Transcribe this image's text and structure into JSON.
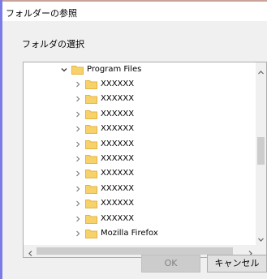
{
  "window": {
    "title": "フォルダーの参照"
  },
  "dialog": {
    "prompt": "フォルダの選択",
    "tree": {
      "root_label": "Program Files",
      "children": [
        "XXXXXX",
        "XXXXXX",
        "XXXXXX",
        "XXXXXX",
        "XXXXXX",
        "XXXXXX",
        "XXXXXX",
        "XXXXXX",
        "XXXXXX",
        "XXXXXX"
      ],
      "partial_child": "Mozilla Firefox"
    },
    "buttons": {
      "ok_label": "OK",
      "cancel_label": "キャンセル",
      "ok_enabled": false
    }
  },
  "colors": {
    "folder": "#f7d26a",
    "folder_dark": "#e3b341",
    "window_border": "#7b7be6",
    "ok_disabled_bg": "#cccccc"
  },
  "icons": {
    "folder": "folder-icon",
    "expand": "chevron-down-icon",
    "collapsed": "chevron-right-icon"
  }
}
